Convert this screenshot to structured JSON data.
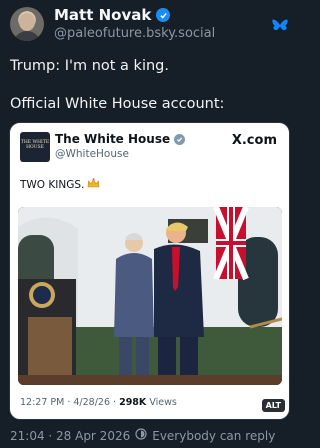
{
  "post": {
    "author_name": "Matt Novak",
    "author_handle": "@paleofuture.bsky.social",
    "text_line1": "Trump: I'm not a king.",
    "text_line2": "Official White House account:",
    "timestamp": "21:04 · 28 Apr 2026",
    "reply_setting": "Everybody can reply"
  },
  "embedded_tweet": {
    "logo_text": "THE WHITE HOUSE",
    "account_name": "The White House",
    "handle": "@WhiteHouse",
    "source_label": "X.com",
    "text": "TWO KINGS.",
    "time": "12:27 PM · 4/28/26 ·",
    "views_count": "298K",
    "views_label": "Views",
    "alt_badge": "ALT"
  },
  "icons": {
    "verified": "verified-check-icon",
    "platform": "bluesky-butterfly-icon",
    "crown": "crown-emoji-icon",
    "reply": "reply-setting-icon"
  },
  "colors": {
    "background": "#161e27",
    "verified_blue": "#1d8cf0",
    "bluesky_blue": "#1185fe"
  }
}
